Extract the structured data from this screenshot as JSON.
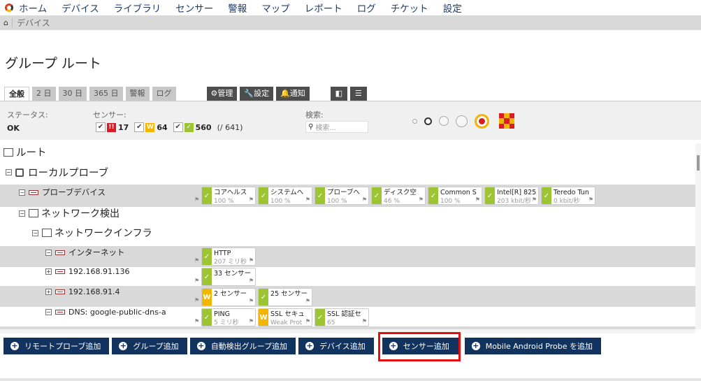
{
  "nav": {
    "items": [
      "ホーム",
      "デバイス",
      "ライブラリ",
      "センサー",
      "警報",
      "マップ",
      "レポート",
      "ログ",
      "チケット",
      "設定"
    ]
  },
  "breadcrumb": {
    "current": "デバイス"
  },
  "page": {
    "title": "グループ ルート"
  },
  "tabs": [
    "全般",
    "2 日",
    "30 日",
    "365 日",
    "警報",
    "ログ"
  ],
  "tools": {
    "manage": "⚙管理",
    "settings": "🔧設定",
    "notify": "🔔通知"
  },
  "status": {
    "status_label": "ステータス:",
    "status_value": "OK",
    "sensor_label": "センサー:",
    "down_count": "17",
    "warning_count": "64",
    "up_count": "560",
    "total": "(/ 641)",
    "search_label": "検索:",
    "search_placeholder": "検索..."
  },
  "colors": {
    "up": "#9dc432",
    "warning": "#f2b600",
    "down": "#d71c23",
    "navy": "#13335f"
  },
  "tree": {
    "root": "ルート",
    "probe": "ローカルプローブ",
    "probe_device": "プローブデバイス",
    "network_discovery": "ネットワーク検出",
    "network_infra": "ネットワークインフラ",
    "internet": "インターネット",
    "host1": "192.168.91.136",
    "host2": "192.168.91.4",
    "dns": "DNS: google-public-dns-a"
  },
  "sensors": {
    "probe": [
      {
        "name": "コアヘルス",
        "value": "100 %",
        "status": "up"
      },
      {
        "name": "システムへ",
        "value": "100 %",
        "status": "up"
      },
      {
        "name": "プローブへ",
        "value": "100 %",
        "status": "up"
      },
      {
        "name": "ディスク空",
        "value": "46 %",
        "status": "up"
      },
      {
        "name": "Common S",
        "value": "100 %",
        "status": "up"
      },
      {
        "name": "Intel[R] 825",
        "value": "203 kbit/秒",
        "status": "up"
      },
      {
        "name": "Teredo Tun",
        "value": "0 kbit/秒",
        "status": "up"
      }
    ],
    "internet": [
      {
        "name": "HTTP",
        "value": "207 ミリ秒",
        "status": "up"
      }
    ],
    "host1": [
      {
        "name": "33 センサー",
        "value": "",
        "status": "up"
      }
    ],
    "host2": [
      {
        "name": "2 センサー",
        "value": "",
        "status": "warning"
      },
      {
        "name": "25 センサー",
        "value": "",
        "status": "up"
      }
    ],
    "dns": [
      {
        "name": "PING",
        "value": "5 ミリ秒",
        "status": "up"
      },
      {
        "name": "SSL セキュ",
        "value": "Weak Prot",
        "status": "warning"
      },
      {
        "name": "SSL 認証セ",
        "value": "65",
        "status": "up"
      }
    ]
  },
  "actions": [
    "リモートプローブ追加",
    "グループ追加",
    "自動検出グループ追加",
    "デバイス追加",
    "センサー追加",
    "Mobile Android Probe を追加"
  ]
}
